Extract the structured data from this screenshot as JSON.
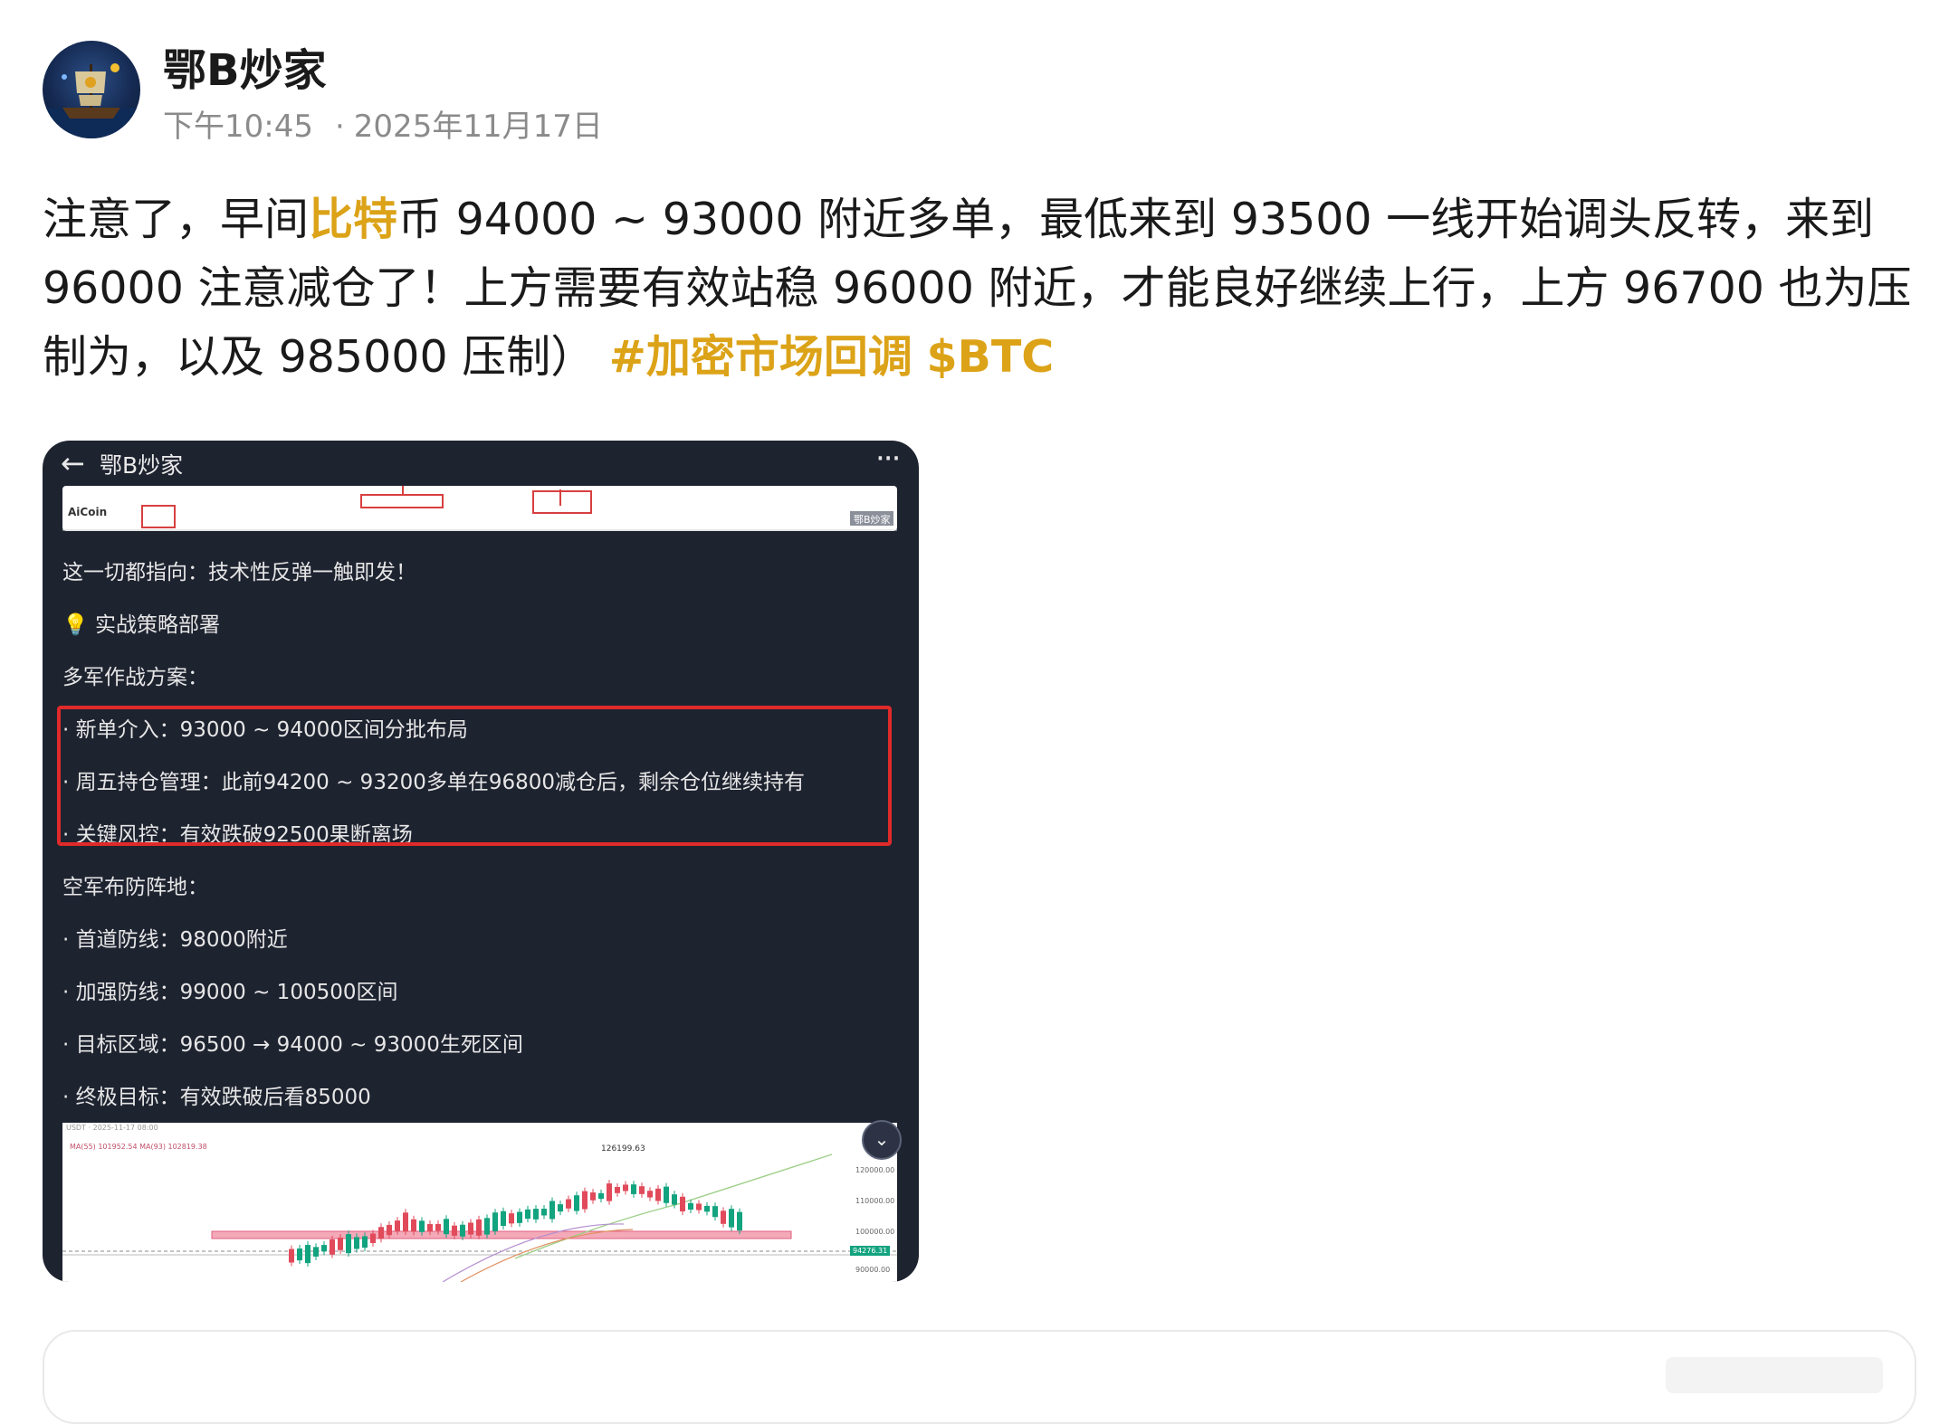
{
  "author": {
    "name": "鄂B炒家",
    "time": "下午10:45",
    "separator": "·",
    "date": "2025年11月17日"
  },
  "post": {
    "t1": "注意了，早间",
    "t2": "比特",
    "t3": "币 94000 ~ 93000 附近多单，最低来到 93500 一线开始调头反转，来到 96000 注意减仓了！上方需要有效站稳 96000 附近，才能良好继续上行，上方 96700 也为压制为，以及 985000 压制）",
    "hashtag": "#加密市场回调",
    "cashtag": "$BTC"
  },
  "image": {
    "back": "←",
    "title": "鄂B炒家",
    "more": "···",
    "lines": [
      "这一切都指向：技术性反弹一触即发！",
      "💡 实战策略部署",
      "多军作战方案：",
      "· 新单介入：93000 ~ 94000区间分批布局",
      "· 周五持仓管理：此前94200 ~ 93200多单在96800减仓后，剩余仓位继续持有",
      "· 关键风控：有效跌破92500果断离场",
      "空军布防阵地：",
      "· 首道防线：98000附近",
      "· 加强防线：99000 ~ 100500区间",
      "· 目标区域：96500 → 94000 ~ 93000生死区间",
      "· 终极目标：有效跌破后看85000"
    ],
    "top_chart": {
      "logo": "AiCoin",
      "watermark": "鄂B炒家"
    },
    "bottom_chart": {
      "header": "USDT · 2025-11-17 08:00",
      "ma_labels": "MA(55) 101952.54  MA(93) 102819.38",
      "peak_label": "126199.63",
      "axis": [
        "120000.00",
        "110000.00",
        "100000.00",
        "90000.00"
      ],
      "current_price": "94276.31"
    }
  },
  "colors": {
    "accent": "#dca318",
    "alert_box": "#e02a2a",
    "card_bg": "#1e2330",
    "up": "#12a37f",
    "down": "#e14a5a"
  }
}
